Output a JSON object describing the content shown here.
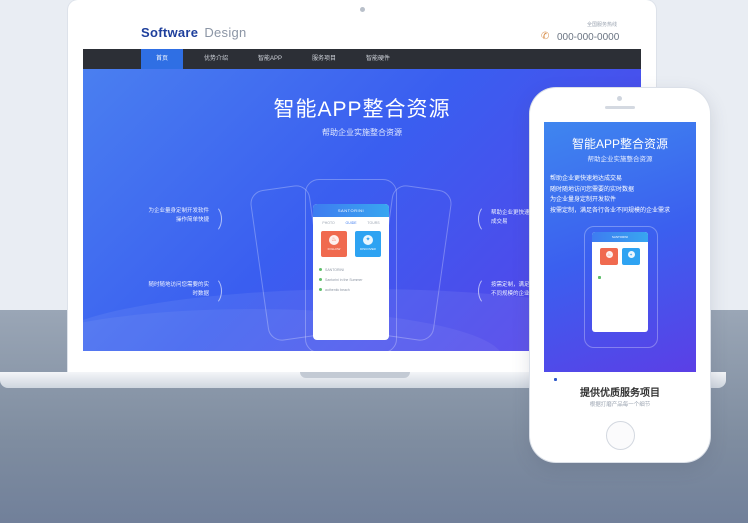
{
  "site": {
    "logo_primary": "Software",
    "logo_secondary": "Design",
    "contact_label": "全国服务热线",
    "phone": "000-000-0000"
  },
  "nav": {
    "items": [
      {
        "label": "首页",
        "active": true
      },
      {
        "label": "优势介绍",
        "active": false
      },
      {
        "label": "智能APP",
        "active": false
      },
      {
        "label": "服务项目",
        "active": false
      },
      {
        "label": "智能硬件",
        "active": false
      }
    ]
  },
  "hero": {
    "title": "智能APP整合资源",
    "subtitle": "帮助企业实施整合资源",
    "features": [
      "为企业量身定制开发软件",
      "操作简单快捷",
      "随时随地访问您需要的实",
      "时数据",
      "帮助企业更快速",
      "成交易",
      "按需定制，满足",
      "不同规模的企业"
    ]
  },
  "mini_app": {
    "brand": "SANTORINI",
    "tabs": [
      "PHOTO",
      "GUIDE",
      "TOURS"
    ],
    "cards": [
      "FOLLOW",
      "DISCOVER"
    ],
    "list": [
      "SANTORINI",
      "Santorini in the Summer",
      "authentic beach"
    ]
  },
  "mobile": {
    "title": "智能APP整合资源",
    "subtitle": "帮助企业实施整合资源",
    "features": [
      "帮助企业更快速地达成交易",
      "随时随地访问您需要的实时数据",
      "为企业量身定制开发软件",
      "按需定制，满足各行各业不同规模的企业需求"
    ],
    "service_title": "提供优质服务项目",
    "service_sub": "根据打磨产品每一个细节"
  },
  "colors": {
    "brand_blue": "#1e3f9c",
    "nav_bg": "#2c2f36",
    "nav_active": "#2f6fe4",
    "hero_start": "#4a7ff0",
    "hero_end": "#5a3fe8"
  }
}
